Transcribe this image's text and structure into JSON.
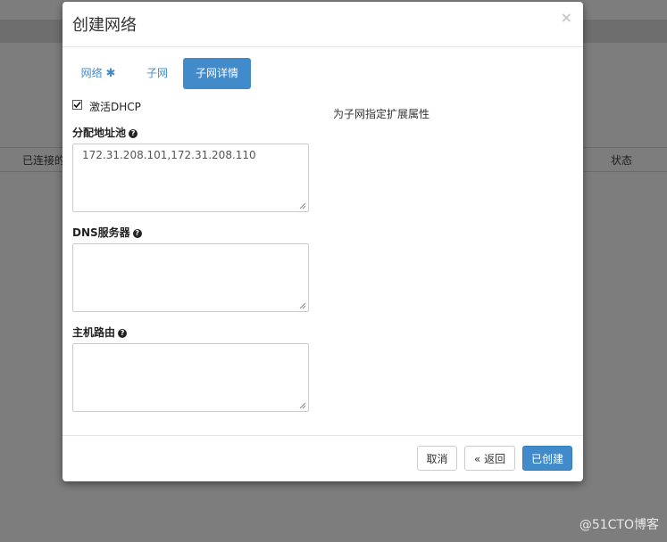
{
  "background": {
    "connected_column": "已连接的",
    "status_column": "状态"
  },
  "modal": {
    "title": "创建网络",
    "close_glyph": "×",
    "tabs": [
      {
        "label": "网络",
        "required_mark": "✱",
        "active": false
      },
      {
        "label": "子网",
        "active": false
      },
      {
        "label": "子网详情",
        "active": true
      }
    ],
    "dhcp": {
      "label": "激活DHCP",
      "checked": true
    },
    "allocation_pools": {
      "label": "分配地址池",
      "value": "172.31.208.101,172.31.208.110"
    },
    "dns_servers": {
      "label": "DNS服务器",
      "value": ""
    },
    "host_routes": {
      "label": "主机路由",
      "value": ""
    },
    "help_text": "为子网指定扩展属性",
    "buttons": {
      "cancel": "取消",
      "back": "« 返回",
      "create": "已创建"
    }
  },
  "watermark": "@51CTO博客",
  "colors": {
    "primary": "#428bca",
    "backdrop": "#7d7d7d"
  },
  "icons": {
    "help": "question-circle-icon",
    "checkbox": "checkbox-checked-icon",
    "close": "close-icon"
  }
}
